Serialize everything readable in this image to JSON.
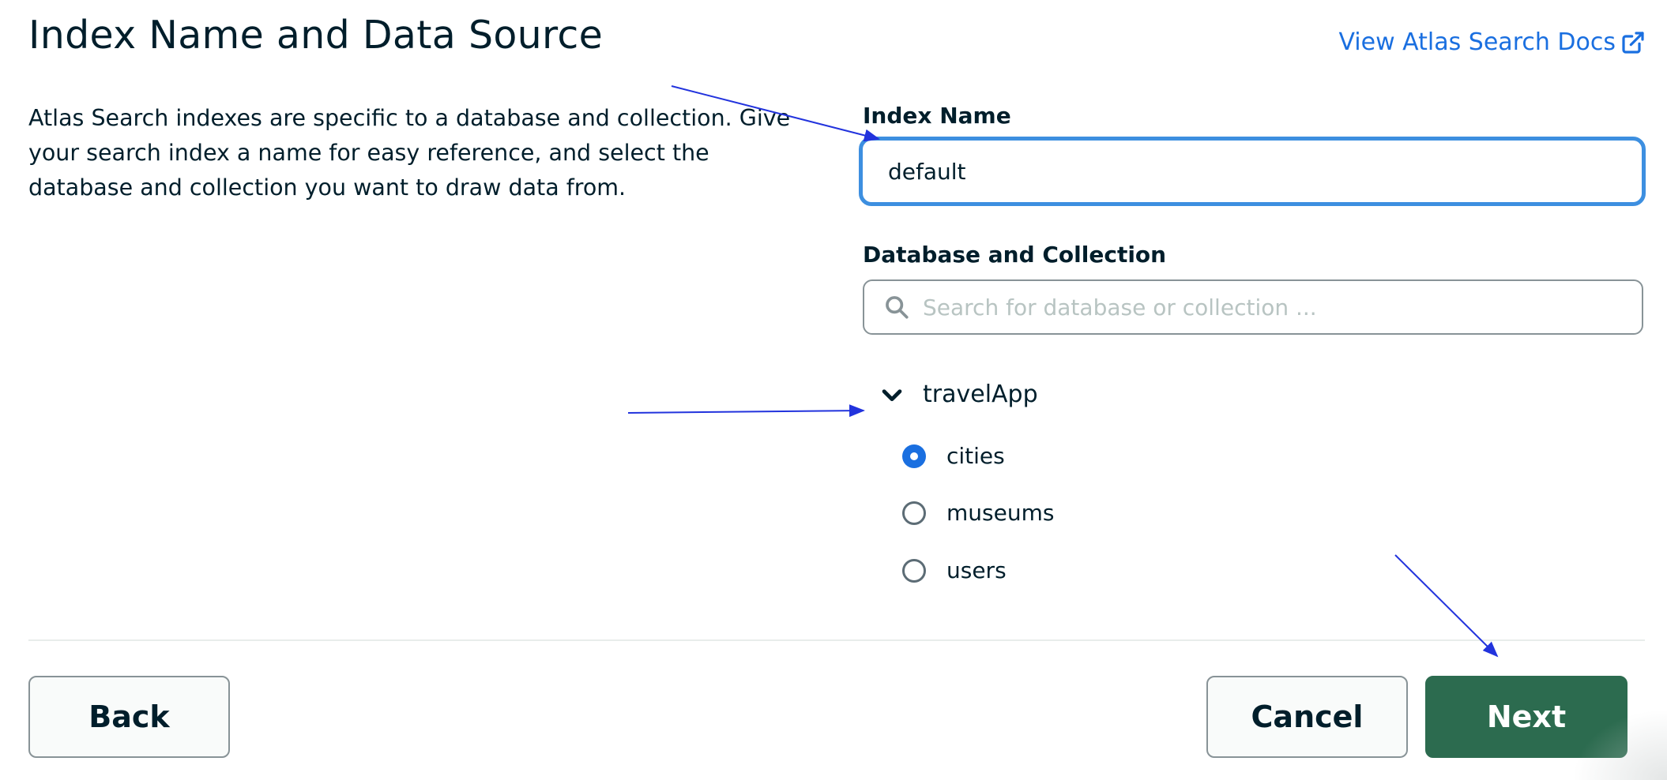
{
  "header": {
    "title": "Index Name and Data Source",
    "docs_link": "View Atlas Search Docs",
    "docs_icon": "external-link-icon"
  },
  "description": "Atlas Search indexes are specific to a database and collection. Give your search index a name for easy reference, and select the database and collection you want to draw data from.",
  "index_name": {
    "label": "Index Name",
    "value": "default"
  },
  "data_source": {
    "label": "Database and Collection",
    "search_placeholder": "Search for database or collection ...",
    "search_icon": "search-icon",
    "database": {
      "name": "travelApp",
      "expanded": true,
      "collections": [
        {
          "name": "cities",
          "selected": true
        },
        {
          "name": "museums",
          "selected": false
        },
        {
          "name": "users",
          "selected": false
        }
      ]
    }
  },
  "footer": {
    "back_label": "Back",
    "cancel_label": "Cancel",
    "next_label": "Next"
  },
  "colors": {
    "accent": "#1a6fe0",
    "primary_button": "#2c6b4f",
    "annotation_arrows": "#2233dd"
  }
}
